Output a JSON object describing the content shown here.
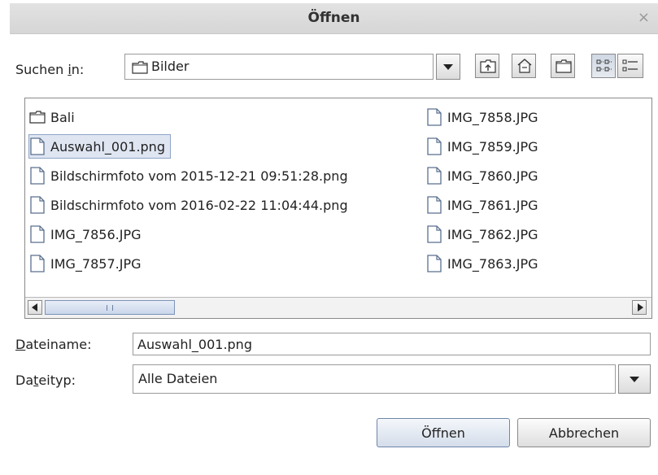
{
  "window": {
    "title": "Öffnen",
    "close_glyph": "×"
  },
  "lookin": {
    "label_pre": "Suchen ",
    "label_key": "i",
    "label_post": "n:",
    "value": "Bilder",
    "icon": "folder-icon"
  },
  "toolbar": {
    "buttons": [
      {
        "name": "up-one-level-button",
        "icon": "folder-up-icon"
      },
      {
        "name": "home-button",
        "icon": "home-icon"
      },
      {
        "name": "new-folder-button",
        "icon": "new-folder-icon"
      },
      {
        "name": "list-view-button",
        "icon": "list-view-icon",
        "pressed": true
      },
      {
        "name": "details-view-button",
        "icon": "details-view-icon"
      }
    ]
  },
  "files": {
    "column1": [
      {
        "name": "Bali",
        "type": "folder"
      },
      {
        "name": "Auswahl_001.png",
        "type": "file",
        "selected": true
      },
      {
        "name": "Bildschirmfoto vom 2015-12-21 09:51:28.png",
        "type": "file"
      },
      {
        "name": "Bildschirmfoto vom 2016-02-22 11:04:44.png",
        "type": "file"
      },
      {
        "name": "IMG_7856.JPG",
        "type": "file"
      },
      {
        "name": "IMG_7857.JPG",
        "type": "file"
      }
    ],
    "column2": [
      {
        "name": "IMG_7858.JPG",
        "type": "file"
      },
      {
        "name": "IMG_7859.JPG",
        "type": "file"
      },
      {
        "name": "IMG_7860.JPG",
        "type": "file"
      },
      {
        "name": "IMG_7861.JPG",
        "type": "file"
      },
      {
        "name": "IMG_7862.JPG",
        "type": "file"
      },
      {
        "name": "IMG_7863.JPG",
        "type": "file"
      }
    ]
  },
  "filename": {
    "label_key": "D",
    "label_post": "ateiname:",
    "value": "Auswahl_001.png"
  },
  "filetype": {
    "label_pre": "Da",
    "label_key": "t",
    "label_post": "eityp:",
    "value": "Alle Dateien"
  },
  "buttons": {
    "open": "Öffnen",
    "cancel": "Abbrechen"
  }
}
